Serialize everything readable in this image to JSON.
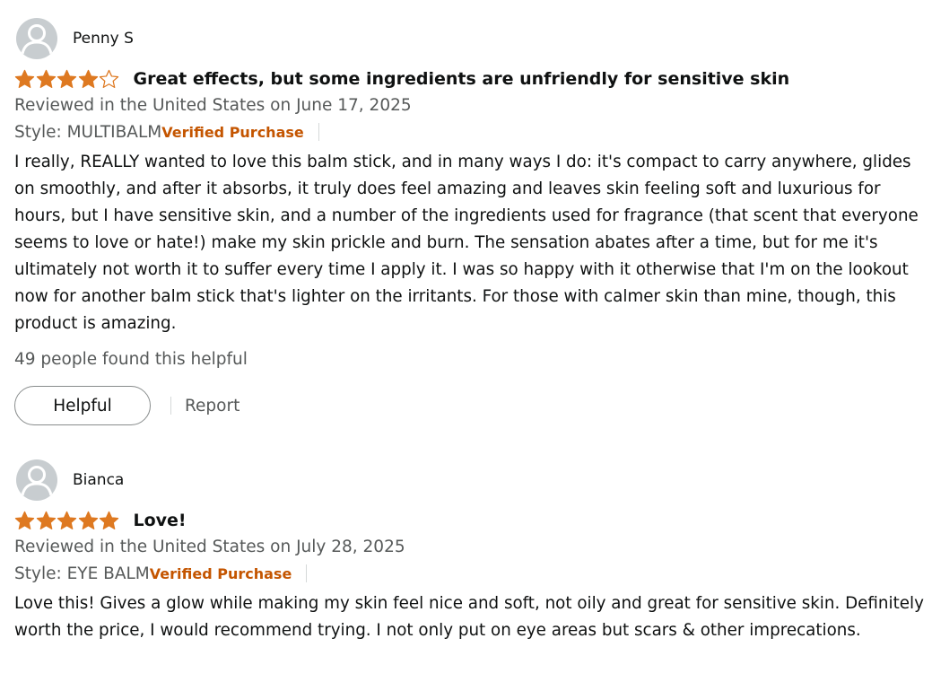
{
  "reviews": [
    {
      "name": "Penny S",
      "rating": 4,
      "max_rating": 5,
      "title": "Great effects, but some ingredients are unfriendly for sensitive skin",
      "date": "Reviewed in the United States on June 17, 2025",
      "style": "Style: MULTIBALM",
      "verified": "Verified Purchase",
      "body": "I really, REALLY wanted to love this balm stick, and in many ways I do: it's compact to carry anywhere, glides on smoothly, and after it absorbs, it truly does feel amazing and leaves skin feeling soft and luxurious for hours, but I have sensitive skin, and a number of the ingredients used for fragrance (that scent that everyone seems to love or hate!) make my skin prickle and burn. The sensation abates after a time, but for me it's ultimately not worth it to suffer every time I apply it. I was so happy with it otherwise that I'm on the lookout now for another balm stick that's lighter on the irritants. For those with calmer skin than mine, though, this product is amazing.",
      "helpful_count": "49 people found this helpful",
      "helpful_label": "Helpful",
      "report_label": "Report"
    },
    {
      "name": "Bianca",
      "rating": 5,
      "max_rating": 5,
      "title": "Love!",
      "date": "Reviewed in the United States on July 28, 2025",
      "style": "Style: EYE BALM",
      "verified": "Verified Purchase",
      "body": "Love this! Gives a glow while making my skin feel nice and soft, not oily and great for sensitive skin. Definitely worth the price, I would recommend trying. I not only put on eye areas but scars & other imprecations."
    }
  ],
  "colors": {
    "star": "#de7921",
    "verified": "#c45500",
    "muted": "#565959",
    "text": "#0f1111"
  },
  "icons": {
    "avatar": "default-user-avatar-icon",
    "star_filled": "star-filled-icon",
    "star_empty": "star-outline-icon"
  }
}
